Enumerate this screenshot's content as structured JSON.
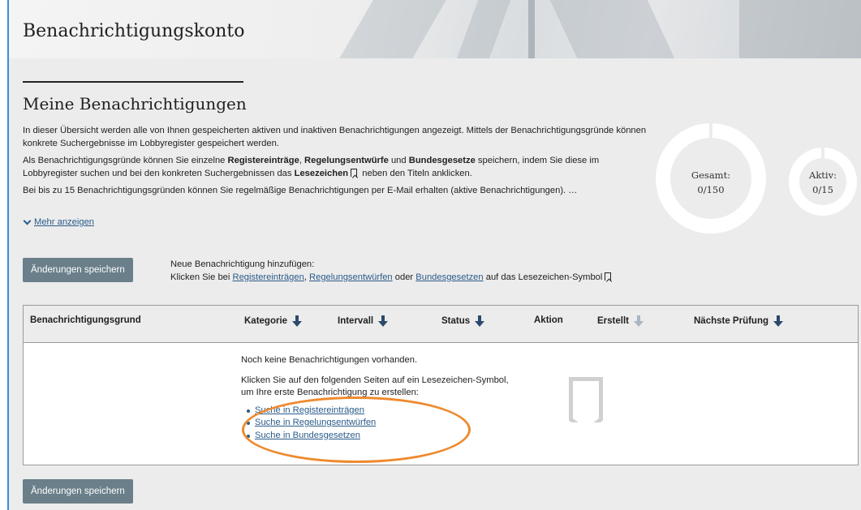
{
  "header": {
    "title": "Benachrichtigungskonto"
  },
  "section": {
    "title": "Meine Benachrichtigungen"
  },
  "intro": {
    "p1": "In dieser Übersicht werden alle von Ihnen gespeicherten aktiven und inaktiven Benachrichtigungen angezeigt. Mittels der Benachrichtigungsgründe können konkrete Suchergebnisse im Lobbyregister gespeichert werden.",
    "p2_a": "Als Benachrichtigungsgründe können Sie einzelne ",
    "p2_b": "Registereinträge",
    "p2_c": ", ",
    "p2_d": "Regelungsentwürfe",
    "p2_e": " und ",
    "p2_f": "Bundesgesetze",
    "p2_g": " speichern, indem Sie diese im Lobbyregister suchen und bei den konkreten Suchergebnissen das ",
    "p2_h": "Lesezeichen",
    "p2_i": " neben den Titeln anklicken.",
    "p3": "Bei bis zu 15 Benachrichtigungsgründen können Sie regelmäßige Benachrichtigungen per E-Mail erhalten (aktive Benachrichtigungen). …",
    "more_label": "Mehr anzeigen"
  },
  "counters": {
    "total_label": "Gesamt:",
    "total_value": "0/150",
    "active_label": "Aktiv:",
    "active_value": "0/15"
  },
  "actions": {
    "save_label": "Änderungen speichern",
    "add_title": "Neue Benachrichtigung hinzufügen:",
    "add_prefix": "Klicken Sie bei ",
    "add_link1": "Registereinträgen",
    "add_sep1": ", ",
    "add_link2": "Regelungsentwürfen",
    "add_sep2": " oder ",
    "add_link3": "Bundesgesetzen",
    "add_suffix": " auf das Lesezeichen-Symbol"
  },
  "table": {
    "columns": [
      "Benachrichtigungsgrund",
      "Kategorie",
      "Intervall",
      "Status",
      "Aktion",
      "Erstellt",
      "Nächste Prüfung"
    ],
    "empty_title": "Noch keine Benachrichtigungen vorhanden.",
    "empty_hint_1": "Klicken Sie auf den folgenden Seiten auf ein Lesezeichen-Symbol,",
    "empty_hint_2": "um Ihre erste Benachrichtigung zu erstellen:",
    "links": [
      "Suche in Registereinträgen",
      "Suche in Regelungsentwürfen",
      "Suche in Bundesgesetzen"
    ]
  },
  "colors": {
    "button": "#6a7f8a",
    "link": "#2a5b8a",
    "sort_arrow": "#2b4a6b",
    "highlight_ellipse": "#ee8a2e",
    "frame_accent": "#3a8fd8"
  },
  "icons": {
    "bookmark": "bookmark-icon",
    "chevron": "chevron-down-icon",
    "sort": "arrow-down-icon"
  }
}
